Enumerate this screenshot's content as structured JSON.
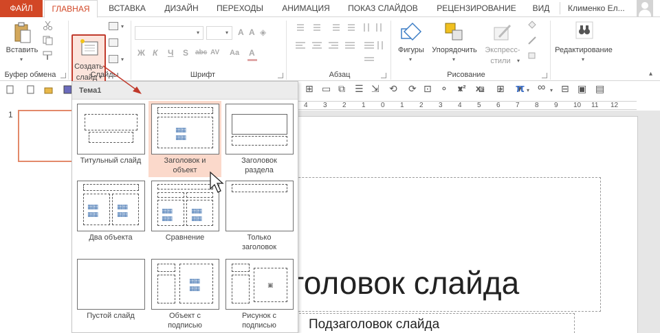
{
  "tabs": [
    {
      "id": "file",
      "label": "ФАЙЛ"
    },
    {
      "id": "home",
      "label": "ГЛАВНАЯ"
    },
    {
      "id": "insert",
      "label": "ВСТАВКА"
    },
    {
      "id": "design",
      "label": "ДИЗАЙН"
    },
    {
      "id": "transitions",
      "label": "ПЕРЕХОДЫ"
    },
    {
      "id": "animation",
      "label": "АНИМАЦИЯ"
    },
    {
      "id": "slideshow",
      "label": "ПОКАЗ СЛАЙДОВ"
    },
    {
      "id": "review",
      "label": "РЕЦЕНЗИРОВАНИЕ"
    },
    {
      "id": "view",
      "label": "ВИД"
    }
  ],
  "active_tab": "ГЛАВНАЯ",
  "user": {
    "name": "Клименко Ел..."
  },
  "ribbon": {
    "clipboard": {
      "paste_label": "Вставить",
      "group_label": "Буфер обмена"
    },
    "slides": {
      "new_slide_line1": "Создать",
      "new_slide_line2": "слайд",
      "group_label": "Слайды"
    },
    "font": {
      "group_label": "Шрифт",
      "buttons": [
        "Ж",
        "К",
        "Ч",
        "S",
        "abc",
        "AV",
        "Aa",
        "A"
      ]
    },
    "paragraph": {
      "group_label": "Абзац"
    },
    "drawing": {
      "shapes_label": "Фигуры",
      "arrange_label": "Упорядочить",
      "quick_styles_line1": "Экспресс-",
      "quick_styles_line2": "стили",
      "group_label": "Рисование"
    },
    "editing": {
      "label": "Редактирование"
    }
  },
  "draw_toolbar": [
    "x²",
    "x₂",
    "π",
    "∞"
  ],
  "ruler": {
    "numbers": [
      "4",
      "3",
      "2",
      "1",
      "0",
      "1",
      "2",
      "3",
      "4",
      "5",
      "6",
      "7",
      "8",
      "9",
      "10",
      "11",
      "12"
    ]
  },
  "thumbnail": {
    "number": "1"
  },
  "slide": {
    "title_text": "головок слайда",
    "subtitle_text": "Подзаголовок слайда"
  },
  "gallery": {
    "header": "Тема1",
    "layouts": [
      {
        "line1": "Титульный слайд",
        "line2": ""
      },
      {
        "line1": "Заголовок и",
        "line2": "объект"
      },
      {
        "line1": "Заголовок",
        "line2": "раздела"
      },
      {
        "line1": "Два объекта",
        "line2": ""
      },
      {
        "line1": "Сравнение",
        "line2": ""
      },
      {
        "line1": "Только",
        "line2": "заголовок"
      },
      {
        "line1": "Пустой слайд",
        "line2": ""
      },
      {
        "line1": "Объект с",
        "line2": "подписью"
      },
      {
        "line1": "Рисунок с",
        "line2": "подписью"
      }
    ],
    "hovered_layout": "Заголовок и объект"
  },
  "colors": {
    "accent": "#d24726",
    "highlight_border": "#c0392b",
    "hover_fill": "#fbd9cb",
    "thumb_border": "#e3896a"
  }
}
